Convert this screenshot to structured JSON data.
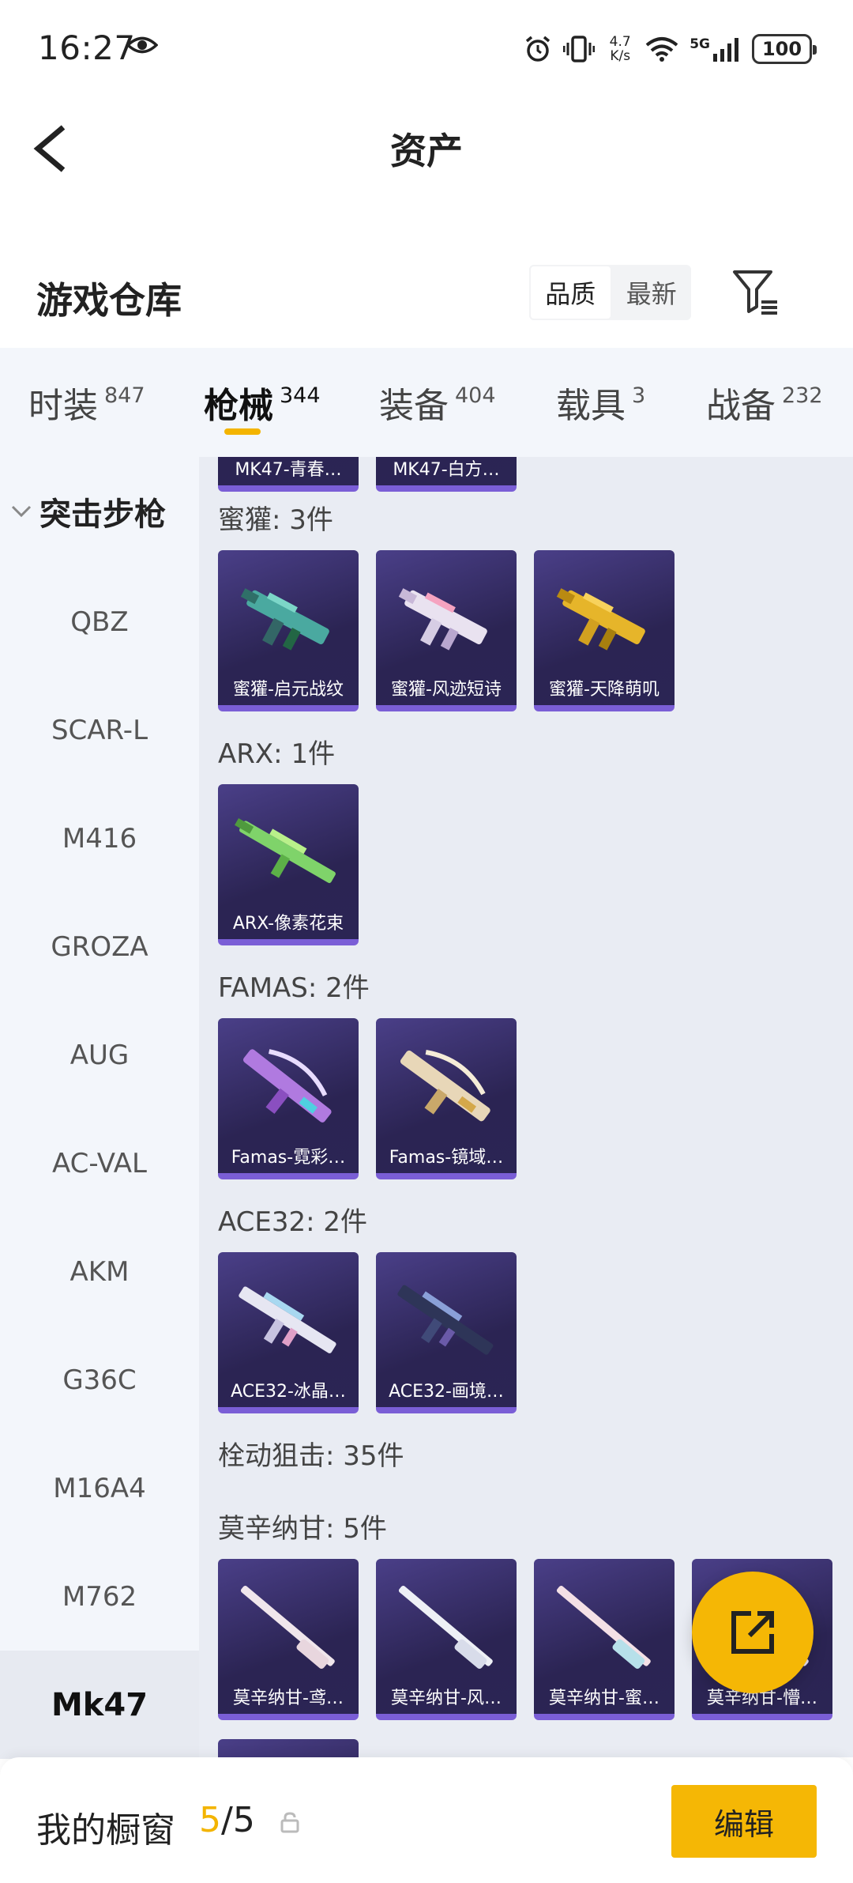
{
  "status_bar": {
    "time": "16:27",
    "net_speed_value": "4.7",
    "net_speed_unit": "K/s",
    "network": "5G",
    "battery": "100"
  },
  "header": {
    "title": "资产"
  },
  "warehouse": {
    "title": "游戏仓库",
    "sort_options": [
      "品质",
      "最新"
    ],
    "sort_active": "品质"
  },
  "tabs": [
    {
      "label": "时装",
      "count": "847"
    },
    {
      "label": "枪械",
      "count": "344"
    },
    {
      "label": "装备",
      "count": "404"
    },
    {
      "label": "载具",
      "count": "3"
    },
    {
      "label": "战备",
      "count": "232"
    }
  ],
  "active_tab": "枪械",
  "sidebar": {
    "group": "突击步枪",
    "items": [
      "QBZ",
      "SCAR-L",
      "M416",
      "GROZA",
      "AUG",
      "AC-VAL",
      "AKM",
      "G36C",
      "M16A4",
      "M762",
      "Mk47"
    ],
    "active": "Mk47"
  },
  "inventory": {
    "partial_top": [
      "MK47-青春…",
      "MK47-白方…"
    ],
    "groups": [
      {
        "title": "蜜獾: 3件",
        "items": [
          "蜜獾-启元战纹",
          "蜜獾-风迹短诗",
          "蜜獾-天降萌叽"
        ]
      },
      {
        "title": "ARX: 1件",
        "items": [
          "ARX-像素花束"
        ]
      },
      {
        "title": "FAMAS: 2件",
        "items": [
          "Famas-霓彩…",
          "Famas-镜域…"
        ]
      },
      {
        "title": "ACE32: 2件",
        "items": [
          "ACE32-冰晶…",
          "ACE32-画境…"
        ]
      },
      {
        "title": "栓动狙击: 35件",
        "items": []
      },
      {
        "title": "莫辛纳甘: 5件",
        "items": [
          "莫辛纳甘-鸢…",
          "莫辛纳甘-风…",
          "莫辛纳甘-蜜…",
          "莫辛纳甘-懵…"
        ]
      }
    ]
  },
  "bottom_bar": {
    "title": "我的橱窗",
    "count_current": "5",
    "count_total": "/5",
    "edit_label": "编辑"
  },
  "colors": {
    "accent": "#f5b705",
    "card_bg": "#2b2453",
    "card_border": "#7a5ed6",
    "sidebar_bg": "#f3f6fb",
    "main_bg": "#e9ecf3"
  }
}
